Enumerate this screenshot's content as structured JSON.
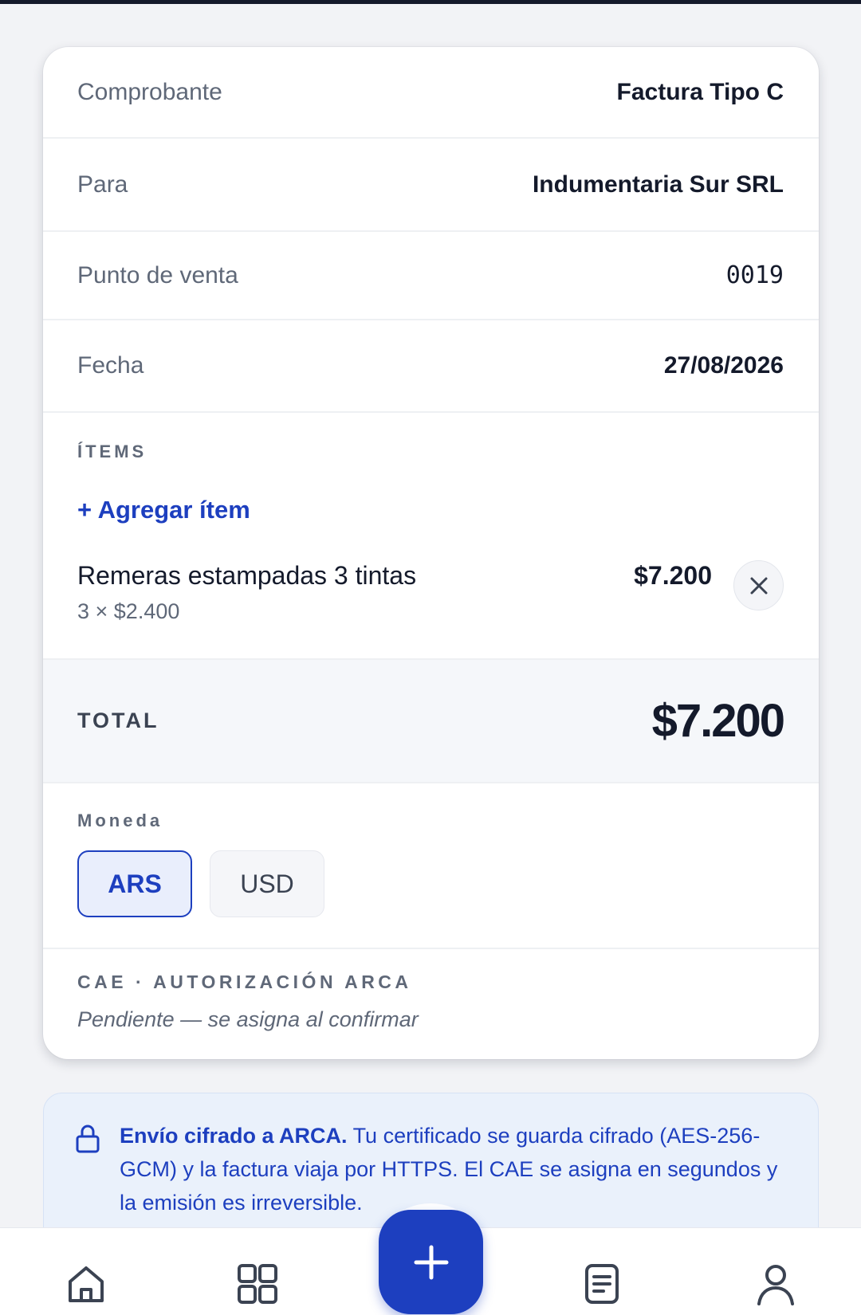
{
  "invoice": {
    "rows": [
      {
        "label": "Comprobante",
        "value": "Factura Tipo C"
      },
      {
        "label": "Para",
        "value": "Indumentaria Sur SRL"
      },
      {
        "label": "Punto de venta",
        "value": "0019"
      },
      {
        "label": "Fecha",
        "value": "27/08/2026"
      }
    ],
    "items_header": "ÍTEMS",
    "add_item_label": "+ Agregar ítem",
    "items": [
      {
        "name": "Remeras estampadas 3 tintas",
        "detail": "3 × $2.400",
        "amount": "$7.200"
      }
    ],
    "total_label": "TOTAL",
    "total_value": "$7.200",
    "currency_label": "Moneda",
    "currencies": [
      {
        "code": "ARS",
        "selected": true
      },
      {
        "code": "USD",
        "selected": false
      }
    ],
    "cae_label": "CAE · AUTORIZACIÓN ARCA",
    "cae_status": "Pendiente — se asigna al confirmar"
  },
  "info_banner": {
    "title": "Envío cifrado a ARCA.",
    "body": "Tu certificado se guarda cifrado (AES-256-GCM) y la factura viaja por HTTPS. El CAE se asigna en segundos y la emisión es irreversible.",
    "icon": "lock-icon"
  },
  "nav": {
    "items": [
      "home-icon",
      "grid-icon",
      "add-icon",
      "document-icon",
      "user-icon"
    ]
  },
  "colors": {
    "accent": "#1d3fbf",
    "text": "#141a2b",
    "muted": "#5f6878",
    "background": "#f2f3f6",
    "banner_background": "#eaf1fb"
  }
}
